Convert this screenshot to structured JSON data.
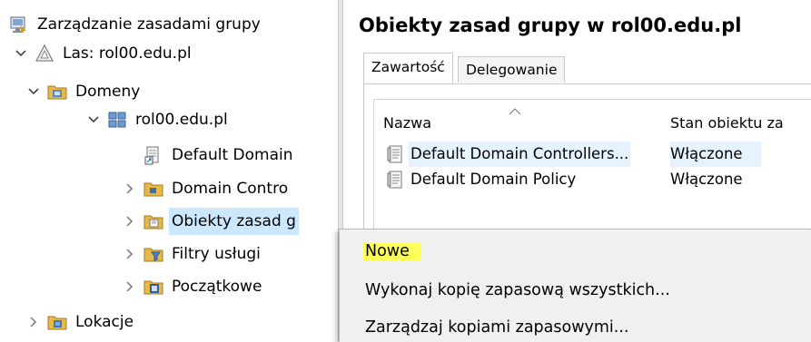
{
  "tree": {
    "root": {
      "label": "Zarządzanie zasadami grupy",
      "icon": "gpm-console-icon"
    },
    "forest": {
      "label": "Las: rol00.edu.pl",
      "icon": "forest-icon"
    },
    "domains": {
      "label": "Domeny",
      "icon": "domains-icon"
    },
    "domain": {
      "label": "rol00.edu.pl",
      "icon": "domain-icon"
    },
    "items": [
      {
        "label": "Default Domain",
        "icon": "gpo-link-icon"
      },
      {
        "label": "Domain Contro",
        "icon": "ou-folder-icon"
      },
      {
        "label": "Obiekty zasad g",
        "icon": "gpo-folder-icon"
      },
      {
        "label": "Filtry usługi",
        "icon": "wmi-filter-folder-icon"
      },
      {
        "label": "Początkowe",
        "icon": "starter-gpo-folder-icon"
      }
    ],
    "sites": {
      "label": "Lokacje",
      "icon": "sites-icon"
    }
  },
  "right": {
    "title": "Obiekty zasad grupy w rol00.edu.pl",
    "tabs": [
      "Zawartość",
      "Delegowanie"
    ],
    "columns": [
      "Nazwa",
      "Stan obiektu za"
    ],
    "rows": [
      {
        "name": "Default Domain Controllers...",
        "state": "Włączone"
      },
      {
        "name": "Default Domain Policy",
        "state": "Włączone"
      }
    ]
  },
  "context_menu": {
    "items": [
      "Nowe",
      "Wykonaj kopię zapasową wszystkich...",
      "Zarządzaj kopiami zapasowymi..."
    ]
  },
  "colors": {
    "selection": "#cce8ff",
    "highlight": "#ffff5a",
    "menu_bg": "#f0f0f0"
  }
}
